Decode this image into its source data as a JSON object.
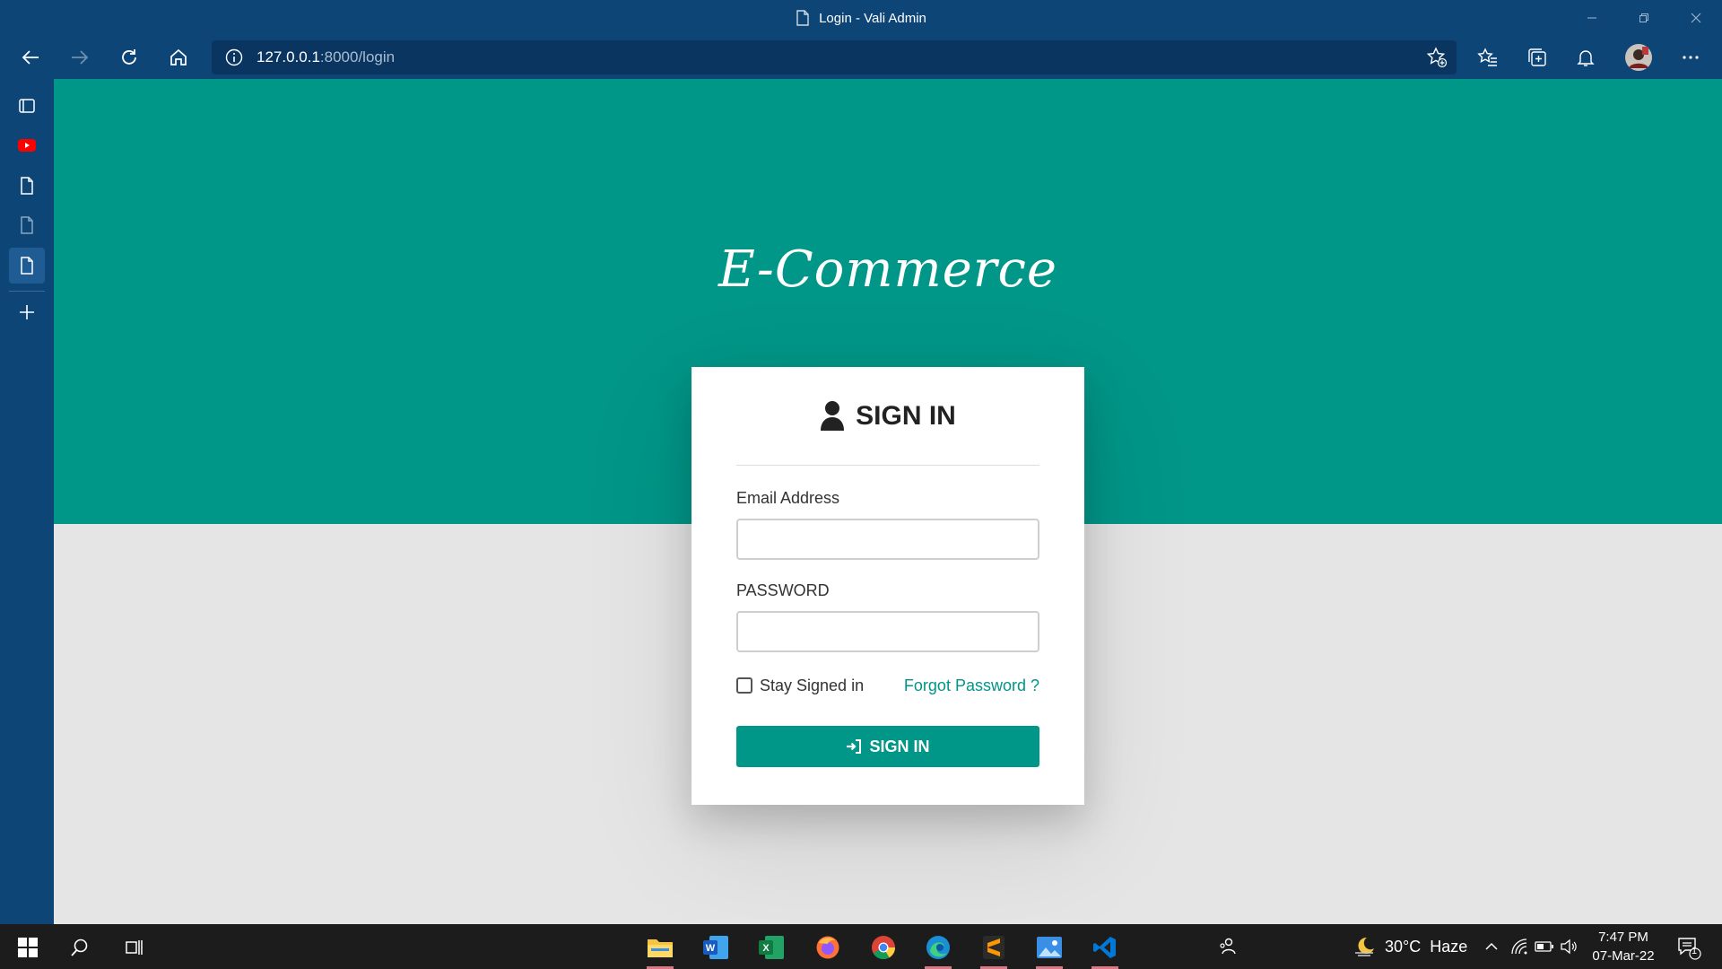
{
  "window": {
    "tab_title": "Login - Vali Admin"
  },
  "toolbar": {
    "url_host": "127.0.0.1",
    "url_path": ":8000/login"
  },
  "page": {
    "logo_text": "E-Commerce",
    "login": {
      "heading": "SIGN IN",
      "email_label": "Email Address",
      "email_value": "",
      "password_label": "PASSWORD",
      "password_value": "",
      "stay_signed_in": "Stay Signed in",
      "forgot_password": "Forgot Password ?",
      "submit_label": "SIGN IN"
    }
  },
  "taskbar": {
    "apps": [
      "file-explorer",
      "word",
      "excel",
      "firefox",
      "chrome",
      "edge",
      "sublime-text",
      "photos",
      "vscode"
    ],
    "weather_temp": "30°C",
    "weather_desc": "Haze",
    "time": "7:47 PM",
    "date": "07-Mar-22",
    "notification_count": "1"
  },
  "colors": {
    "brand": "#009688",
    "browser_chrome": "#0e4577",
    "taskbar": "#1c1c1c"
  }
}
